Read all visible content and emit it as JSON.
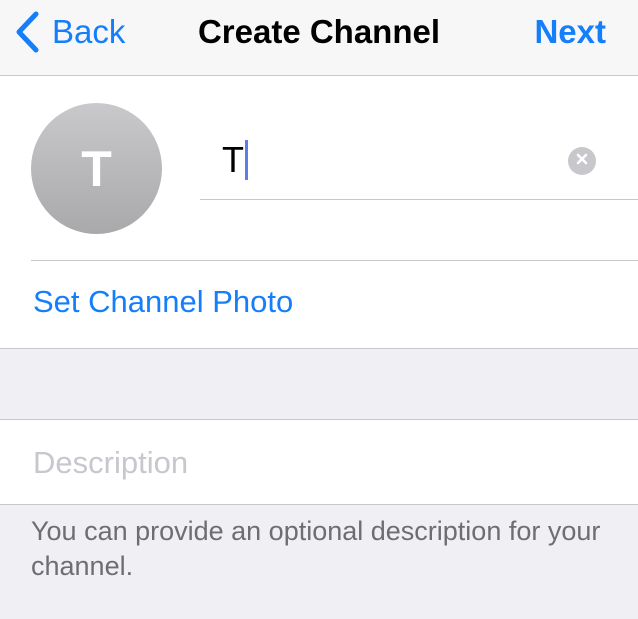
{
  "nav": {
    "back_label": "Back",
    "title": "Create Channel",
    "next_label": "Next"
  },
  "channel": {
    "avatar_letter": "T",
    "name_value": "T",
    "set_photo_label": "Set Channel Photo"
  },
  "description": {
    "placeholder": "Description",
    "value": "",
    "note": "You can provide an optional description for your channel."
  },
  "colors": {
    "accent": "#157efb",
    "background": "#efeff4",
    "avatar_gray": "#b9b9bb",
    "caret": "#5b7fe6"
  },
  "icons": {
    "back": "chevron-left-icon",
    "clear": "clear-x-icon"
  }
}
